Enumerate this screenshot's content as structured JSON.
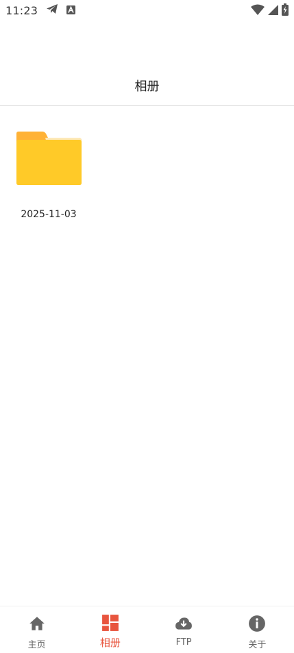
{
  "status_bar": {
    "time": "11:23",
    "left_icons": [
      "telegram-icon",
      "a-notification-icon"
    ],
    "right_icons": [
      "wifi-icon",
      "signal-icon",
      "battery-charging-icon"
    ]
  },
  "header": {
    "title": "相册"
  },
  "albums": [
    {
      "label": "2025-11-03",
      "icon": "folder-icon"
    }
  ],
  "bottom_nav": {
    "active_color": "#e8553e",
    "items": [
      {
        "label": "主页",
        "icon": "home-icon",
        "active": false
      },
      {
        "label": "相册",
        "icon": "album-grid-icon",
        "active": true
      },
      {
        "label": "FTP",
        "icon": "cloud-download-icon",
        "active": false
      },
      {
        "label": "关于",
        "icon": "info-icon",
        "active": false
      }
    ]
  }
}
